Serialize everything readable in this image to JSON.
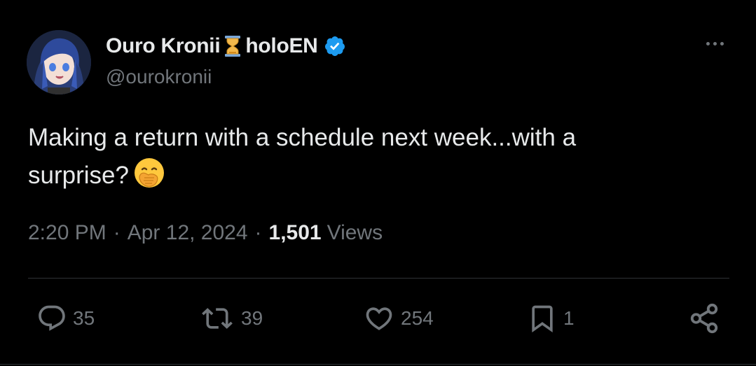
{
  "author": {
    "display_name_part1": "Ouro Kronii",
    "display_name_part2": "holoEN",
    "handle": "@ourokronii"
  },
  "tweet": {
    "text_line1": "Making a return with a schedule next week...with a",
    "text_line2": "surprise?",
    "emoji": "face-with-hand-over-mouth-emoji"
  },
  "meta": {
    "time": "2:20 PM",
    "separator": "·",
    "date": "Apr 12, 2024",
    "views_count": "1,501",
    "views_label": "Views"
  },
  "actions": {
    "replies": "35",
    "reposts": "39",
    "likes": "254",
    "bookmarks": "1"
  },
  "icons": {
    "verified": "verified-badge-icon",
    "hourglass": "hourglass-icon",
    "more": "more-icon",
    "reply": "reply-icon",
    "repost": "repost-icon",
    "like": "heart-icon",
    "bookmark": "bookmark-icon",
    "share": "share-icon"
  },
  "colors": {
    "background": "#000000",
    "text": "#e7e9ea",
    "secondary": "#71767b",
    "verified": "#1d9bf0",
    "divider": "#2f3336"
  }
}
